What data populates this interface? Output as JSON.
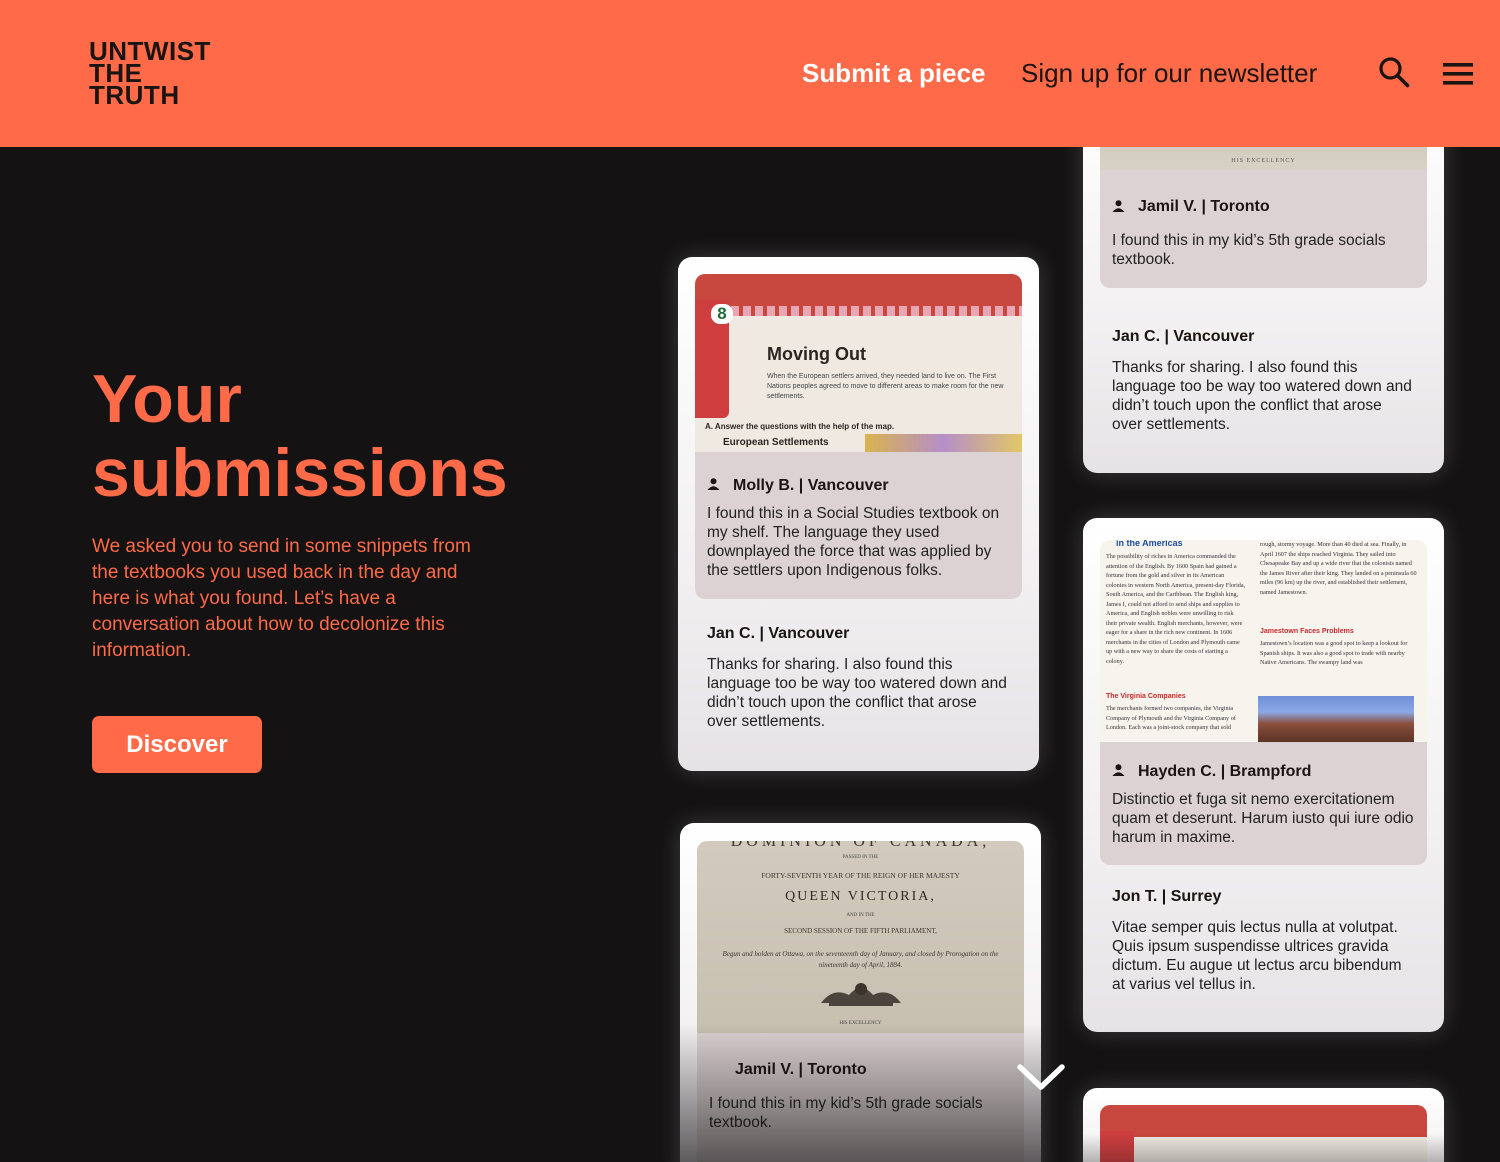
{
  "header": {
    "logo_lines": [
      "UNTWIST",
      "THE",
      "TRUTH"
    ],
    "submit_label": "Submit a piece",
    "newsletter_label": "Sign up for our newsletter",
    "search_icon": "search-icon",
    "menu_icon": "hamburger-menu-icon",
    "bg_color": "#ff6a48"
  },
  "hero": {
    "title_lines": [
      "Your",
      "submissions"
    ],
    "description": "We asked you to send in some snippets from the textbooks you used back in the day and here is what you found. Let’s have a conversation about how to decolonize this information.",
    "cta_label": "Discover"
  },
  "cards": {
    "top_right": {
      "image_caption": "HIS EXCELLENCY",
      "author": "Jamil V. | Toronto",
      "text": "I found this in my kid’s 5th grade socials textbook.",
      "reply_author": "Jan C. | Vancouver",
      "reply_text": "Thanks for sharing. I also found this language too be way too watered down and didn’t touch upon the conflict that arose over settlements."
    },
    "molly": {
      "image": {
        "chapter": "8",
        "heading": "Moving Out",
        "body": "When the European settlers arrived, they needed land to live on. The First Nations peoples agreed to move to different areas to make room for the new settlements.",
        "question": "A.   Answer the questions with the help of the map.",
        "map_label": "European Settlements"
      },
      "author": "Molly B. | Vancouver",
      "text": "I found this in a Social Studies textbook on my shelf. The language they used downplayed the force that was applied by the settlers upon Indigenous folks.",
      "reply_author": "Jan C. | Vancouver",
      "reply_text": "Thanks for sharing. I also found this language too be way too watered down and didn’t touch upon the conflict that arose over settlements."
    },
    "hayden": {
      "image": {
        "heading": "in the Americas",
        "col1": "The possibility of riches in America commanded the attention of the English. By 1600 Spain had gained a fortune from the gold and silver in its American colonies in western North America, present-day Florida, South America, and the Caribbean. The English king, James I, could not afford to send ships and supplies to America, and English nobles were unwilling to risk their private wealth. English merchants, however, were eager for a share in the rich new continent. In 1606 merchants in the cities of London and Plymouth came up with a new way to share the costs of starting a colony.",
        "sub1": "The Virginia Companies",
        "col1b": "The merchants formed two companies, the Virginia Company of Plymouth and the Virginia Company of London. Each was a joint-stock company that sold",
        "col2": "rough, stormy voyage. More than 40 died at sea. Finally, in April 1607 the ships reached Virginia. They sailed into Chesapeake Bay and up a wide river that the colonists named the James River after their king. They landed on a peninsula 60 miles (96 km) up the river, and established their settlement, named Jamestown.",
        "sub2": "Jamestown Faces Problems",
        "col2b": "Jamestown’s location was a good spot to keep a lookout for Spanish ships. It was also a good spot to trade with nearby Native Americans. The swampy land was"
      },
      "author": "Hayden C. | Brampford",
      "text": "Distinctio et fuga sit nemo exercitationem quam et deserunt. Harum iusto qui iure odio harum in maxime.",
      "reply_author": "Jon T. | Surrey",
      "reply_text": "Vitae semper quis lectus nulla at volutpat. Quis ipsum suspendisse ultrices gravida dictum. Eu augue ut lectus arcu bibendum at varius vel tellus in."
    },
    "jamil_bottom": {
      "image": {
        "line0": "DOMINION OF CANADA,",
        "line1": "PASSED IN THE",
        "line2": "FORTY-SEVENTH YEAR OF THE REIGN OF HER MAJESTY",
        "line3": "QUEEN VICTORIA,",
        "line4": "AND IN THE",
        "line5": "SECOND SESSION OF THE FIFTH PARLIAMENT,",
        "line6": "Begun and holden at Ottawa, on the seventeenth day of January, and closed by Prorogation on the nineteenth day of April, 1884.",
        "line7": "HIS EXCELLENCY"
      },
      "author": "Jamil V. | Toronto",
      "text": "I found this in my kid’s 5th grade socials textbook."
    }
  },
  "scroll": {
    "icon": "chevron-down-icon"
  },
  "colors": {
    "accent": "#ff6a48",
    "background": "#141213",
    "card_sub": "#ddd2d3"
  }
}
